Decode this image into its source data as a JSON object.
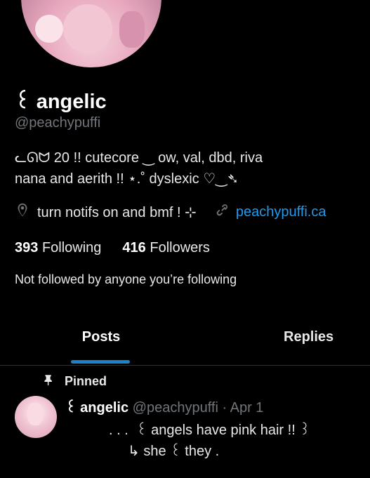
{
  "profile": {
    "display_name": "꒰ angelic",
    "handle": "@peachypuffi",
    "bio_line1": "ᓚᘏᗢ 20 !! cutecore ‿ ow, val, dbd, riva",
    "bio_line2": "nana and aerith !! ⋆.˚ dyslexic ♡‿➴",
    "location": "turn notifs on and bmf ! ⊹",
    "url": "peachypuffi.ca",
    "following_count": "393",
    "following_label": "Following",
    "followers_count": "416",
    "followers_label": "Followers",
    "followed_by": "Not followed by anyone you’re following"
  },
  "tabs": [
    {
      "label": "Posts",
      "active": true
    },
    {
      "label": "Replies",
      "active": false
    }
  ],
  "pinned_post": {
    "pinned_label": "Pinned",
    "author_name": "꒰ angelic",
    "author_handle": "@peachypuffi",
    "date": "Apr 1",
    "line1": ". . .  ꒰ angels have pink hair !! ꒱",
    "line2": "↳ she ꒰ they ."
  },
  "colors": {
    "background": "#000000",
    "text": "#e7e9ea",
    "muted": "#71767b",
    "accent": "#1d9bf0"
  },
  "icons": [
    "location-icon",
    "link-icon",
    "pin-icon"
  ]
}
